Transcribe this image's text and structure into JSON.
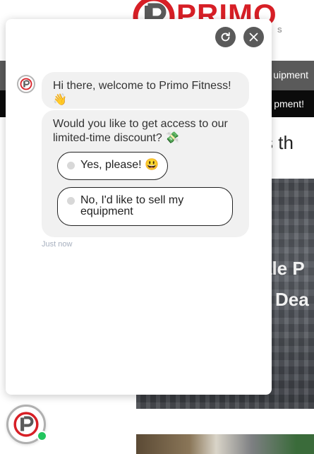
{
  "site": {
    "logo_text": "PRIMO",
    "logo_sub_text": "S",
    "nav_text": "uipment",
    "promo_text": "pment!",
    "heading_fragment": "s is th",
    "hero_line1": "ale P",
    "hero_line2": "Dea"
  },
  "chat": {
    "messages": [
      {
        "text": "Hi there, welcome to Primo Fitness! 👋"
      },
      {
        "text": "Would you like to get access to our limited-time discount? 💸"
      }
    ],
    "options": [
      {
        "label": "Yes, please! 😃"
      },
      {
        "label": "No, I'd like to sell my equipment"
      }
    ],
    "timestamp": "Just now",
    "controls": {
      "refresh_icon": "refresh-icon",
      "close_icon": "close-icon"
    }
  },
  "colors": {
    "brand_red": "#d71f26",
    "control_gray": "#5a5a5a",
    "online_green": "#22c55e"
  }
}
